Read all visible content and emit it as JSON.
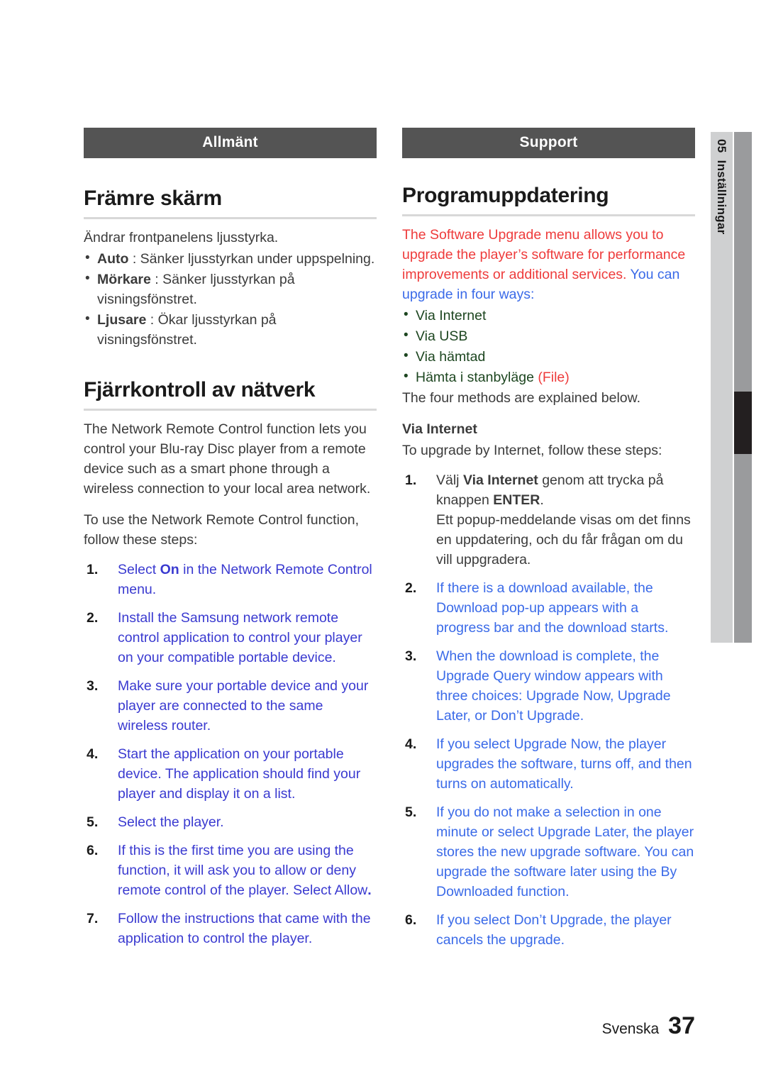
{
  "document": {
    "language_label": "Svenska",
    "page_number": "37"
  },
  "chapter_tab": {
    "number": "05",
    "name": "Inställningar"
  },
  "colors": {
    "banner_bg": "#545454",
    "text_black": "#3b3b3b",
    "text_blue_left": "#3a3ad0",
    "text_blue_right": "#3a6ae8",
    "text_red": "#ee3b3b",
    "text_green": "#1d4620",
    "rule": "#d8d8d8",
    "tab_light": "#cfd0d1",
    "tab_dark": "#9a9b9d",
    "tab_mark": "#231f20"
  },
  "left_column": {
    "banner": "Allmänt",
    "section1": {
      "title": "Främre skärm",
      "intro": "Ändrar frontpanelens ljusstyrka.",
      "bullets": [
        {
          "term": "Auto",
          "rest": " : Sänker ljusstyrkan under uppspelning."
        },
        {
          "term": "Mörkare",
          "rest": " : Sänker ljusstyrkan på visningsfönstret."
        },
        {
          "term": "Ljusare",
          "rest": " : Ökar ljusstyrkan på visningsfönstret."
        }
      ]
    },
    "section2": {
      "title": "Fjärrkontroll av nätverk",
      "para1": "The Network Remote Control function lets you control your Blu-ray Disc player from a remote device such as a smart phone through a wireless connection to your local area network.",
      "para2": "To use the Network Remote Control function, follow these steps:",
      "steps": [
        {
          "num": "1.",
          "pre": "Select ",
          "bold": "On",
          "post": " in the Network Remote Control menu."
        },
        {
          "num": "2.",
          "pre": "Install the Samsung network remote control application to control your player on your compatible portable device.",
          "bold": "",
          "post": ""
        },
        {
          "num": "3.",
          "pre": "Make sure your portable device and your player are connected to the same wireless router.",
          "bold": "",
          "post": ""
        },
        {
          "num": "4.",
          "pre": "Start the application on your portable device. The application should find your player and display it on a list.",
          "bold": "",
          "post": ""
        },
        {
          "num": "5.",
          "pre": "Select the player.",
          "bold": "",
          "post": ""
        },
        {
          "num": "6.",
          "pre": "If this is the first time you are using the function, it will ask you to allow or deny remote control of the player. Select Allow",
          "bold": ".",
          "post": ""
        },
        {
          "num": "7.",
          "pre": "Follow the instructions that came with the application to control the player.",
          "bold": "",
          "post": ""
        }
      ]
    }
  },
  "right_column": {
    "banner": "Support",
    "section1": {
      "title": "Programuppdatering",
      "intro_red": "The Software Upgrade menu allows you to upgrade the player’s software for performance improvements or additional services. ",
      "intro_blue": "You can upgrade in four ways:",
      "bullets": [
        {
          "text": "Via Internet",
          "suffix": ""
        },
        {
          "text": "Via USB",
          "suffix": ""
        },
        {
          "text": "Via hämtad",
          "suffix": ""
        },
        {
          "text": "Hämta i stanbyläge",
          "suffix": " (File)"
        }
      ],
      "after_bullets": "The four methods are explained below.",
      "subheading": "Via Internet",
      "sub_intro": "To upgrade by Internet, follow these steps:",
      "steps": [
        {
          "num": "1.",
          "seg_pre": "Välj ",
          "seg_bold1": "Via Internet",
          "seg_mid": " genom att trycka på knappen ",
          "seg_bold2": "ENTER",
          "seg_post": ".",
          "extra": "Ett popup-meddelande visas om det finns en uppdatering, och du får frågan om du vill uppgradera."
        },
        {
          "num": "2.",
          "text": "If there is a download available, the Download pop-up appears with a progress bar and the download starts."
        },
        {
          "num": "3.",
          "text": "When the download is complete, the Upgrade Query window appears with three choices: Upgrade Now, Upgrade Later, or Don’t Upgrade."
        },
        {
          "num": "4.",
          "text": "If you select Upgrade Now, the player upgrades the software, turns off, and then turns on automatically."
        },
        {
          "num": "5.",
          "text": "If you do not make a selection in one minute or select Upgrade Later, the player stores the new upgrade software. You can upgrade the software later using the By Downloaded function."
        },
        {
          "num": "6.",
          "text": "If you select Don’t Upgrade, the player cancels the upgrade."
        }
      ]
    }
  }
}
